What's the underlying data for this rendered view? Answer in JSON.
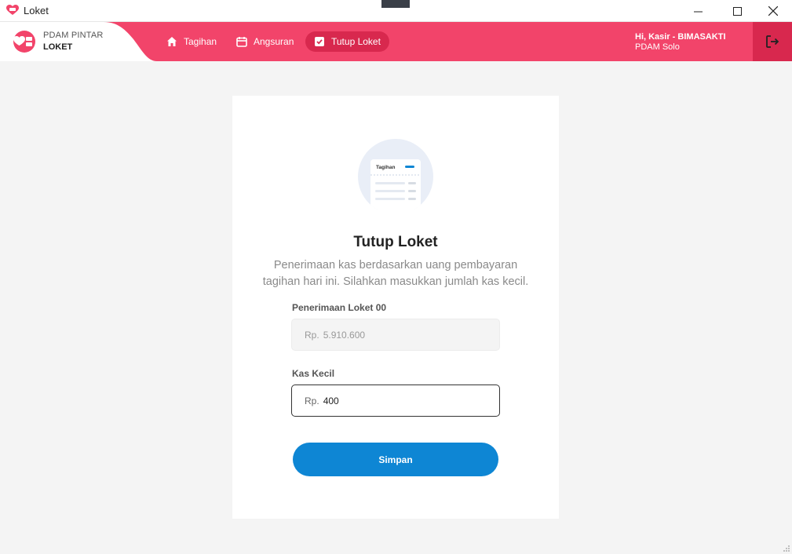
{
  "window": {
    "title": "Loket",
    "controls": {
      "minimize": "minimize-icon",
      "maximize": "maximize-icon",
      "close": "close-icon"
    }
  },
  "header": {
    "brand_line1": "PDAM PINTAR",
    "brand_line2": "LOKET",
    "nav": [
      {
        "label": "Tagihan",
        "icon": "home-icon",
        "active": false
      },
      {
        "label": "Angsuran",
        "icon": "calendar-icon",
        "active": false
      },
      {
        "label": "Tutup Loket",
        "icon": "checkbox-icon",
        "active": true
      }
    ],
    "user_greeting": "Hi, Kasir - BIMASAKTI",
    "user_org": "PDAM Solo",
    "logout_icon": "logout-icon"
  },
  "colors": {
    "brand": "#f2446a",
    "brand_dark": "#d8284e",
    "primary_button": "#0e86d4"
  },
  "main": {
    "illustration_label": "Tagihan",
    "title": "Tutup Loket",
    "description": "Penerimaan kas berdasarkan uang pembayaran tagihan hari ini. Silahkan masukkan jumlah kas kecil.",
    "penerimaan": {
      "label": "Penerimaan Loket 00",
      "prefix": "Rp.",
      "value": "5.910.600"
    },
    "kas_kecil": {
      "label": "Kas Kecil",
      "prefix": "Rp.",
      "value": "400"
    },
    "submit_label": "Simpan"
  }
}
